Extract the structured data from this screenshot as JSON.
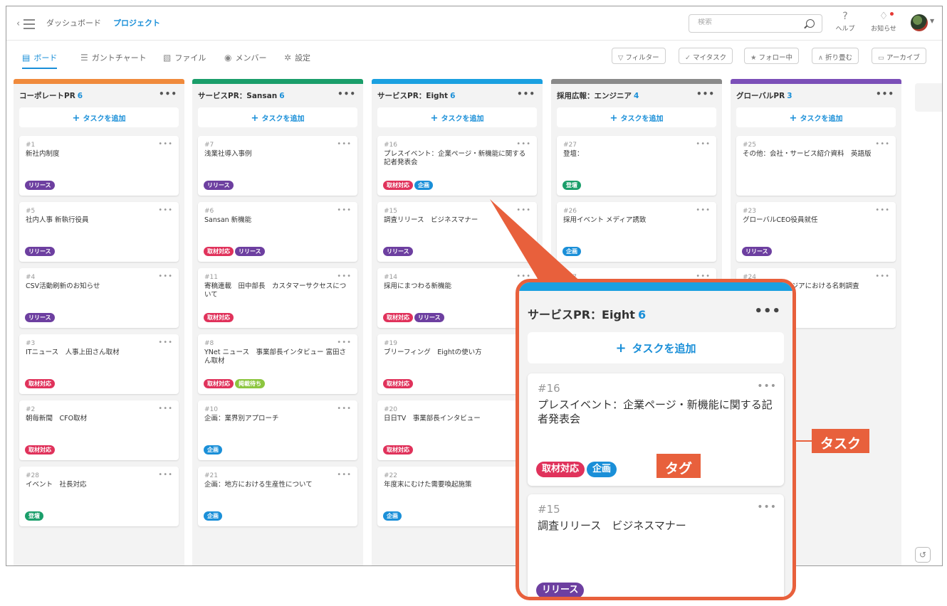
{
  "header": {
    "breadcrumb": [
      "ダッシュボード",
      "プロジェクト"
    ],
    "search_placeholder": "検索",
    "help_label": "ヘルプ",
    "notifications_label": "お知らせ"
  },
  "tabs": [
    {
      "label": "ボード",
      "icon": "board-icon",
      "active": true
    },
    {
      "label": "ガントチャート",
      "icon": "gantt-icon",
      "active": false
    },
    {
      "label": "ファイル",
      "icon": "file-icon",
      "active": false
    },
    {
      "label": "メンバー",
      "icon": "members-icon",
      "active": false
    },
    {
      "label": "設定",
      "icon": "gear-icon",
      "active": false
    }
  ],
  "filters": [
    {
      "label": "フィルター",
      "icon": "filter-icon"
    },
    {
      "label": "マイタスク",
      "icon": "check-icon"
    },
    {
      "label": "フォロー中",
      "icon": "star-icon"
    },
    {
      "label": "折り畳む",
      "icon": "collapse-icon"
    },
    {
      "label": "アーカイブ",
      "icon": "folder-icon"
    }
  ],
  "add_task_label": "タスクを追加",
  "tag_colors": {
    "リリース": "#6d3fa0",
    "取材対応": "#e0325b",
    "企画": "#1a8fd8",
    "登壇": "#1a9e6a",
    "掲載待ち": "#8cc63f"
  },
  "columns": [
    {
      "name": "コーポレートPR",
      "count": "6",
      "color": "#f08a3c",
      "cards": [
        {
          "num": "#1",
          "title": "新社内制度",
          "tags": [
            "リリース"
          ]
        },
        {
          "num": "#5",
          "title": "社内人事 新執行役員",
          "tags": [
            "リリース"
          ]
        },
        {
          "num": "#4",
          "title": "CSV活動刷新のお知らせ",
          "tags": [
            "リリース"
          ]
        },
        {
          "num": "#3",
          "title": "ITニュース　人事上田さん取材",
          "tags": [
            "取材対応"
          ]
        },
        {
          "num": "#2",
          "title": "朝毎新聞　CFO取材",
          "tags": [
            "取材対応"
          ]
        },
        {
          "num": "#28",
          "title": "イベント　社長対応",
          "tags": [
            "登壇"
          ]
        }
      ]
    },
    {
      "name": "サービスPR：Sansan",
      "count": "6",
      "color": "#1a9e6a",
      "cards": [
        {
          "num": "#7",
          "title": "浅業社導入事例",
          "tags": [
            "リリース"
          ]
        },
        {
          "num": "#6",
          "title": "Sansan 新機能",
          "tags": [
            "取材対応",
            "リリース"
          ]
        },
        {
          "num": "#11",
          "title": "寄稿連載　田中部長　カスタマーサクセスについて",
          "tags": [
            "取材対応"
          ]
        },
        {
          "num": "#8",
          "title": "YNet ニュース　事業部長インタビュー 富田さん取材",
          "tags": [
            "取材対応",
            "掲載待ち"
          ]
        },
        {
          "num": "#10",
          "title": "企画：業界別アプローチ",
          "tags": [
            "企画"
          ]
        },
        {
          "num": "#21",
          "title": "企画：地方における生産性について",
          "tags": [
            "企画"
          ]
        }
      ]
    },
    {
      "name": "サービスPR：Eight",
      "count": "6",
      "color": "#1aa0e0",
      "cards": [
        {
          "num": "#16",
          "title": "プレスイベント：企業ページ・新機能に関する記者発表会",
          "tags": [
            "取材対応",
            "企画"
          ]
        },
        {
          "num": "#15",
          "title": "調査リリース　ビジネスマナー",
          "tags": [
            "リリース"
          ]
        },
        {
          "num": "#14",
          "title": "採用にまつわる新機能",
          "tags": [
            "取材対応",
            "リリース"
          ]
        },
        {
          "num": "#19",
          "title": "ブリーフィング　Eightの使い方",
          "tags": [
            "取材対応"
          ]
        },
        {
          "num": "#20",
          "title": "日日TV　事業部長インタビュー",
          "tags": [
            "取材対応"
          ]
        },
        {
          "num": "#22",
          "title": "年度末にむけた需要喚起施策",
          "tags": [
            "企画"
          ]
        }
      ]
    },
    {
      "name": "採用広報：エンジニア",
      "count": "4",
      "color": "#8a8a8a",
      "cards": [
        {
          "num": "#27",
          "title": "登壇：",
          "tags": [
            "登壇"
          ]
        },
        {
          "num": "#26",
          "title": "採用イベント メディア誘致",
          "tags": [
            "企画"
          ]
        },
        {
          "num": "#17",
          "title": "",
          "tags": []
        }
      ]
    },
    {
      "name": "グローバルPR",
      "count": "3",
      "color": "#7b4fb8",
      "cards": [
        {
          "num": "#25",
          "title": "その他：会社・サービス紹介資料　英語版",
          "tags": []
        },
        {
          "num": "#23",
          "title": "グローバルCEO役員就任",
          "tags": [
            "リリース"
          ]
        },
        {
          "num": "#24",
          "title": "調査リリース アジアにおける名刺調査",
          "tags": []
        }
      ]
    }
  ],
  "callout": {
    "column_name": "サービスPR：Eight",
    "count": "6",
    "cards": [
      {
        "num": "#16",
        "title": "プレスイベント：企業ページ・新機能に関する記者発表会",
        "tags": [
          "取材対応",
          "企画"
        ]
      },
      {
        "num": "#15",
        "title": "調査リリース　ビジネスマナー",
        "tags": [
          "リリース"
        ]
      }
    ],
    "label_task": "タスク",
    "label_tag": "タグ"
  },
  "accent_color": "#1a8fd8",
  "callout_color": "#e8603c"
}
